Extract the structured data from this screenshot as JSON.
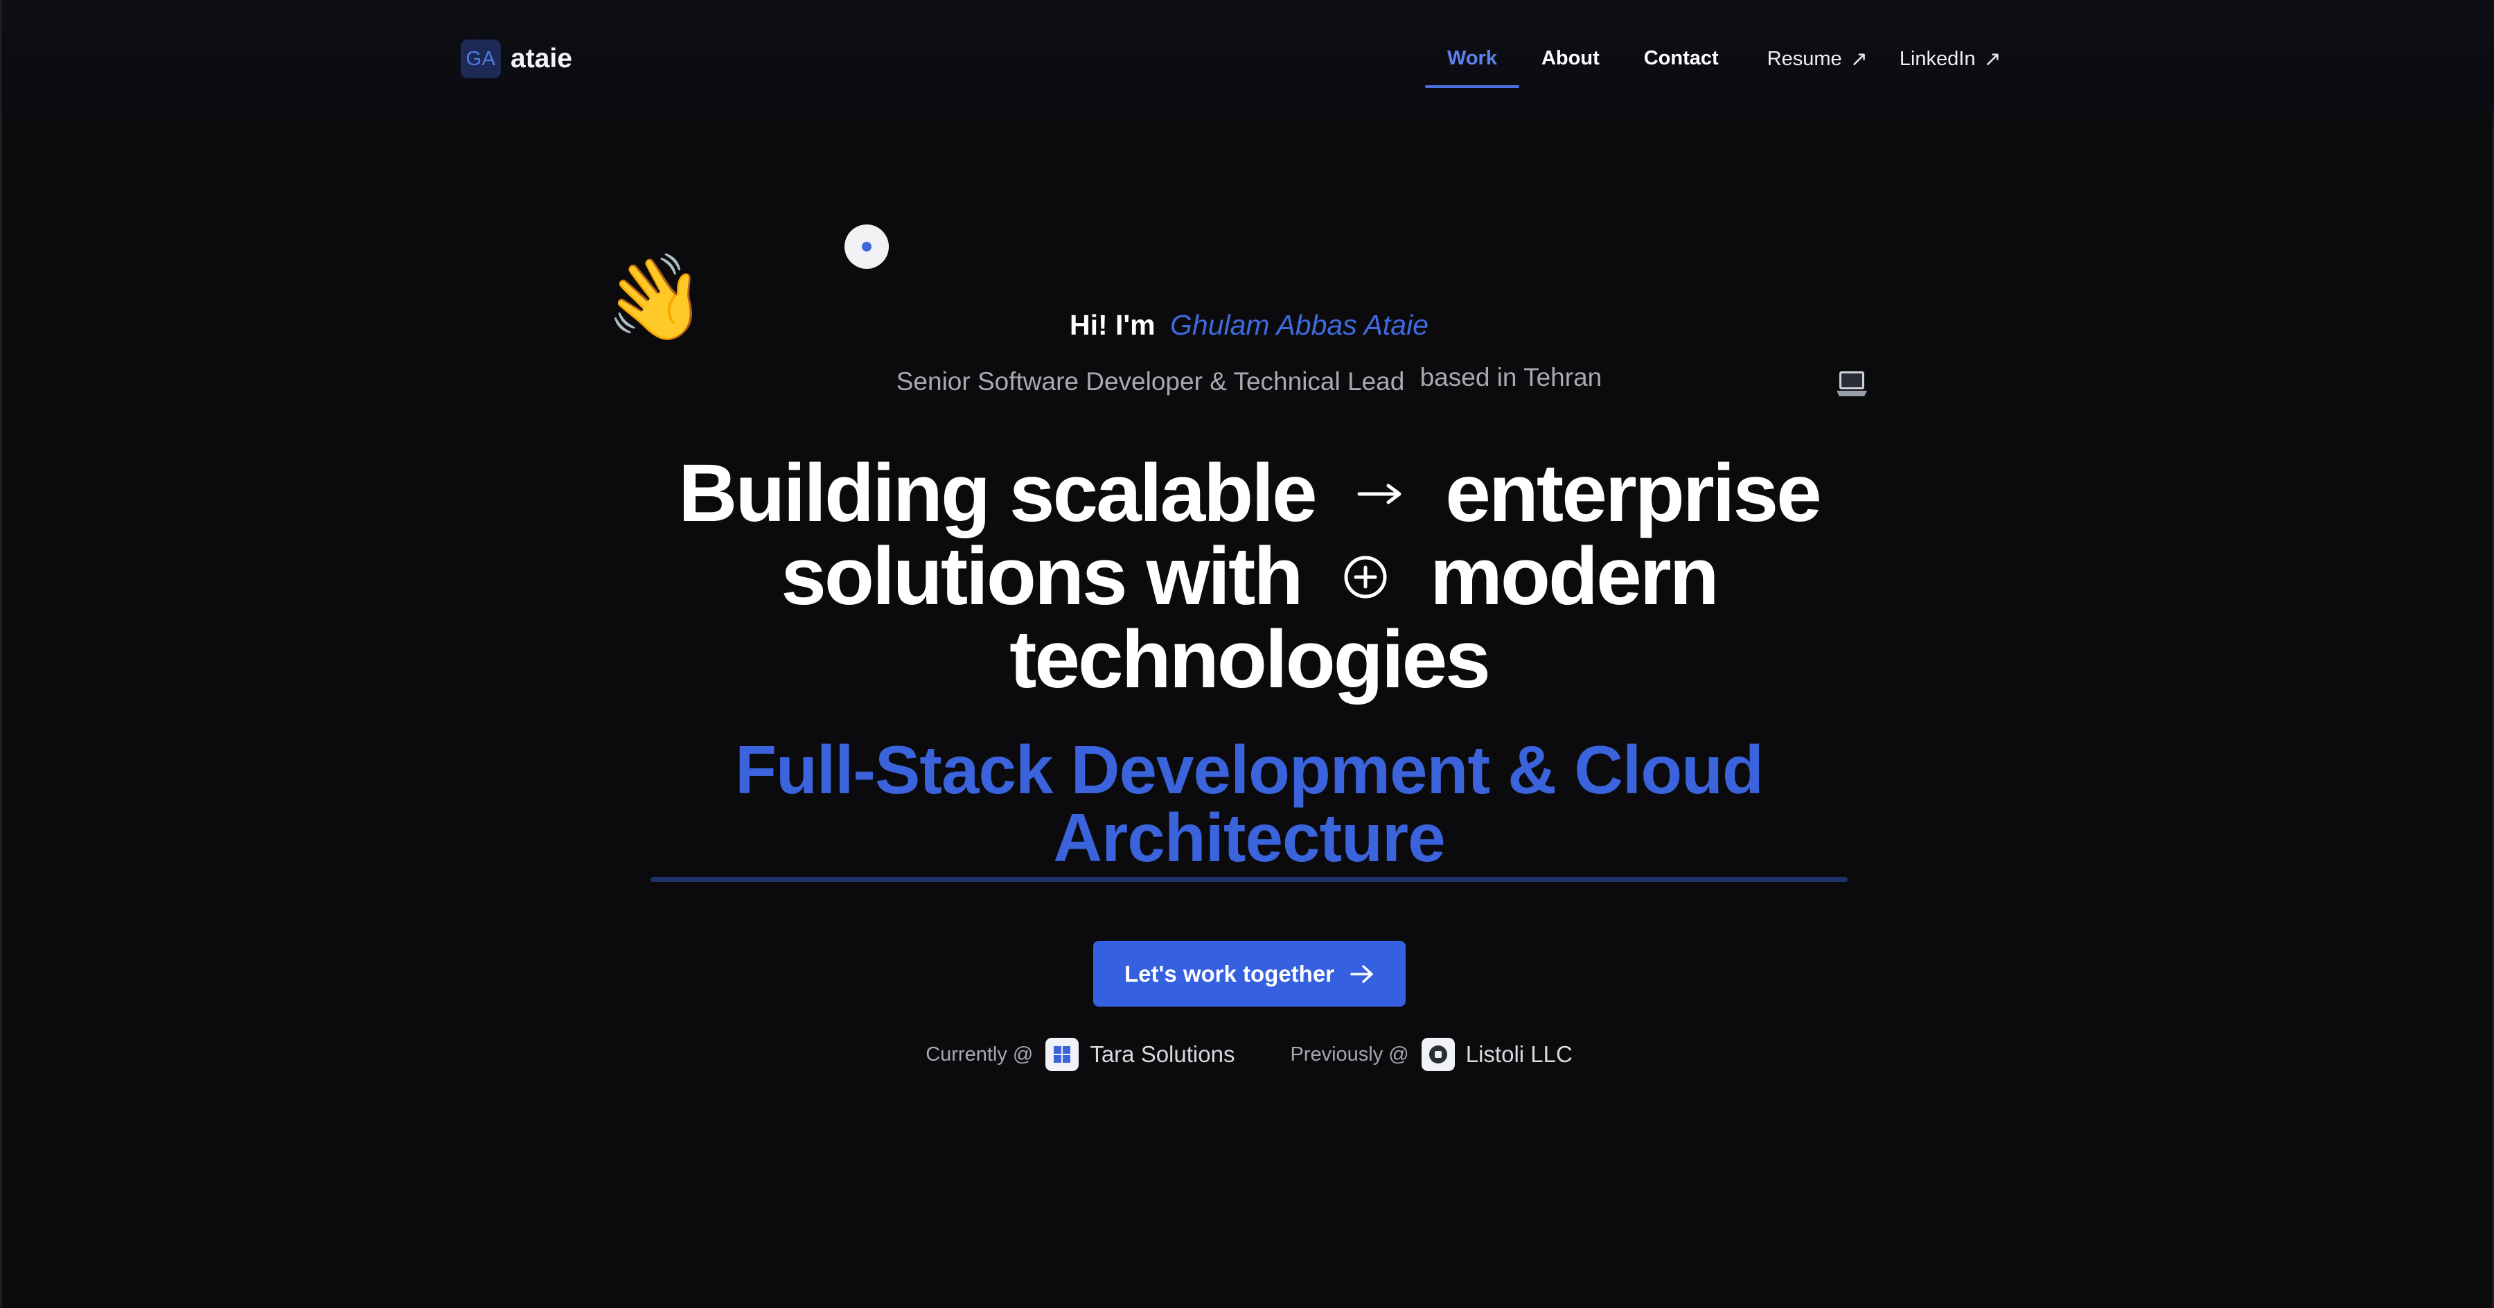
{
  "brand": {
    "badge": "GA",
    "name": "ataie"
  },
  "nav": {
    "items": [
      {
        "label": "Work",
        "active": true
      },
      {
        "label": "About",
        "active": false
      },
      {
        "label": "Contact",
        "active": false
      }
    ],
    "external": [
      {
        "label": "Resume",
        "icon": "arrow-up-right-icon"
      },
      {
        "label": "LinkedIn",
        "icon": "arrow-up-right-icon"
      }
    ]
  },
  "hero": {
    "greeting_prefix": "Hi! I'm",
    "greeting_name": "Ghulam Abbas Ataie",
    "role": "Senior Software Developer & Technical Lead",
    "location": "based in Tehran",
    "headline": {
      "line1_a": "Building scalable",
      "line1_b": "enterprise",
      "line2_a": "solutions with",
      "line2_b": "modern",
      "line3": "technologies"
    },
    "tagline": {
      "line1": "Full-Stack Development & Cloud",
      "line2": "Architecture"
    },
    "cta_label": "Let's work together"
  },
  "work": {
    "current_label": "Currently @",
    "current_company": "Tara Solutions",
    "previous_label": "Previously @",
    "previous_company": "Listoli LLC"
  },
  "colors": {
    "background": "#0b0b0d",
    "accent": "#3a63dc",
    "cta": "#3560e0",
    "text_muted": "#a9a9b0"
  }
}
